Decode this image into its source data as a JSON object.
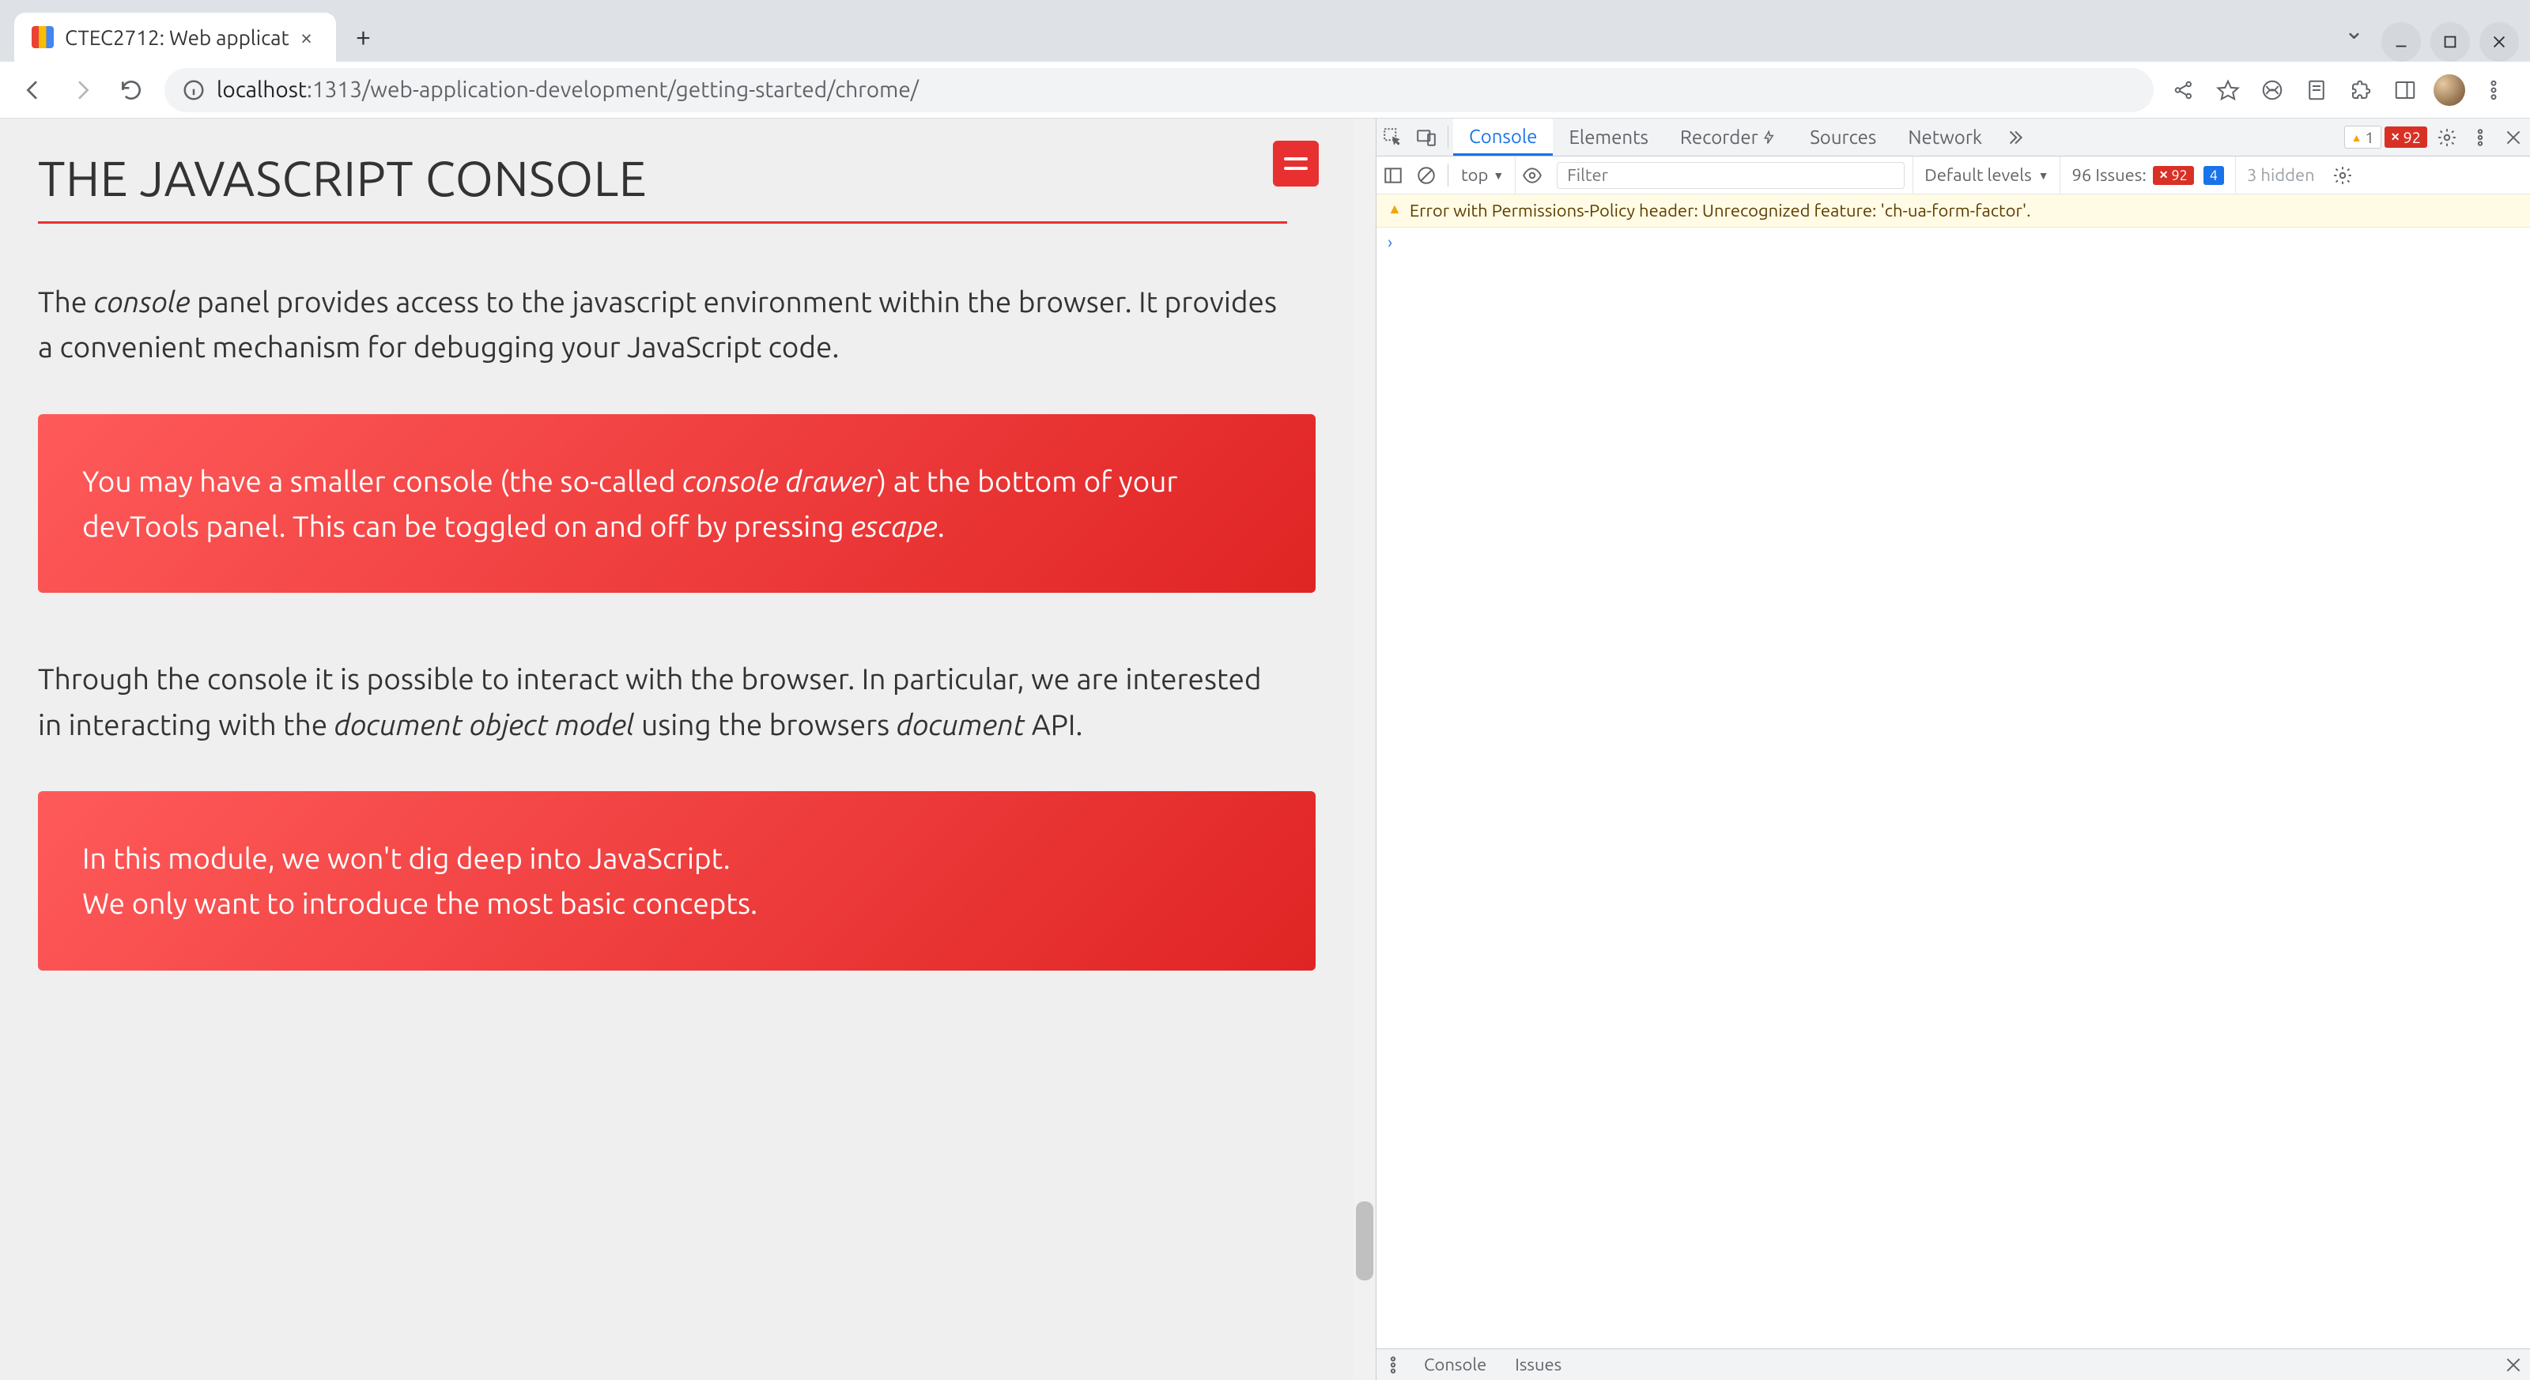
{
  "tab": {
    "title": "CTEC2712: Web applicat"
  },
  "omnibox": {
    "host": "localhost",
    "port_path": ":1313/web-application-development/getting-started/chrome/"
  },
  "page": {
    "heading": "THE JAVASCRIPT CONSOLE",
    "p1_pre": "The ",
    "p1_em": "console",
    "p1_post": " panel provides access to the javascript environment within the browser. It provides a convenient mechanism for debugging your JavaScript code.",
    "callout1_a": "You may have a smaller console (the so-called ",
    "callout1_em1": "console drawer",
    "callout1_b": ") at the bottom of your devTools panel. This can be toggled on and off by pressing ",
    "callout1_em2": "escape",
    "callout1_c": ".",
    "p2_a": "Through the console it is possible to interact with the browser. In particular, we are interested in interacting with the ",
    "p2_em1": "document object model",
    "p2_b": " using the browsers ",
    "p2_em2": "document",
    "p2_c": " API.",
    "callout2_a": "In this module, we won't dig deep into JavaScript.",
    "callout2_b": "We only want to introduce the most basic concepts."
  },
  "devtools": {
    "tabs": [
      "Console",
      "Elements",
      "Recorder",
      "Sources",
      "Network"
    ],
    "active_tab": "Console",
    "warn_count": "1",
    "err_count": "92",
    "context": "top",
    "filter_placeholder": "Filter",
    "levels": "Default levels",
    "issues_label": "96 Issues:",
    "issues_err": "92",
    "issues_info": "4",
    "hidden": "3 hidden",
    "message": "Error with Permissions-Policy header: Unrecognized feature: 'ch-ua-form-factor'.",
    "prompt": "›",
    "drawer": {
      "tabs": [
        "Console",
        "Issues"
      ]
    }
  }
}
